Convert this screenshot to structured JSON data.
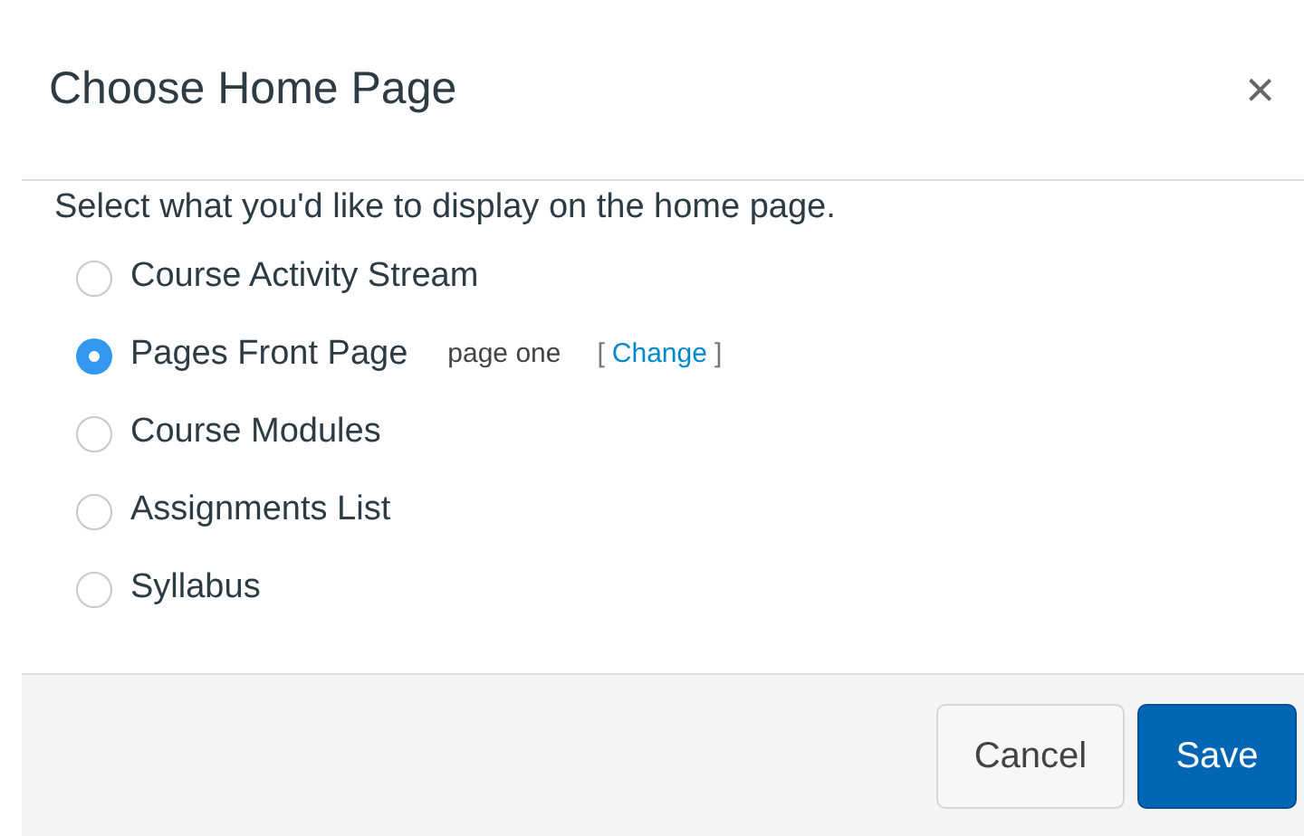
{
  "dialog": {
    "title": "Choose Home Page",
    "close": "×"
  },
  "prompt": "Select what you'd like to display on the home page.",
  "options": [
    {
      "label": "Course Activity Stream",
      "selected": false
    },
    {
      "label": "Pages Front Page",
      "selected": true,
      "detail": "page one",
      "link": {
        "open": "[",
        "label": "Change",
        "close": "]"
      }
    },
    {
      "label": "Course Modules",
      "selected": false
    },
    {
      "label": "Assignments List",
      "selected": false
    },
    {
      "label": "Syllabus",
      "selected": false
    }
  ],
  "buttons": [
    {
      "label": "Cancel",
      "kind": "secondary"
    },
    {
      "label": "Save",
      "kind": "primary"
    }
  ]
}
